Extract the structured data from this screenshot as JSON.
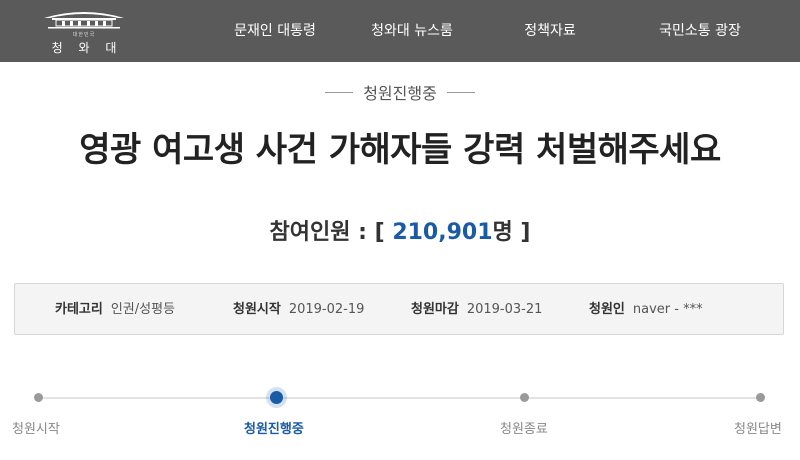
{
  "header": {
    "logo": {
      "subtitle": "대한민국",
      "name": "청 와 대"
    },
    "nav": [
      {
        "label": "문재인 대통령"
      },
      {
        "label": "청와대 뉴스룸"
      },
      {
        "label": "정책자료"
      },
      {
        "label": "국민소통 광장"
      }
    ]
  },
  "petition": {
    "status": "청원진행중",
    "title": "영광 여고생 사건 가해자들 강력 처벌해주세요",
    "participants": {
      "label": "참여인원 : [ ",
      "count": "210,901",
      "unit": "명 ]"
    },
    "info": [
      {
        "key": "카테고리",
        "value": "인권/성평등"
      },
      {
        "key": "청원시작",
        "value": "2019-02-19"
      },
      {
        "key": "청원마감",
        "value": "2019-03-21"
      },
      {
        "key": "청원인",
        "value": "naver - ***"
      }
    ]
  },
  "progress": {
    "steps": [
      {
        "label": "청원시작"
      },
      {
        "label": "청원진행중"
      },
      {
        "label": "청원종료"
      },
      {
        "label": "청원답변"
      }
    ],
    "current_step": 2
  },
  "colors": {
    "header_bg": "#5a5a5a",
    "accent": "#1a5ba6",
    "info_bg": "#f4f4f4"
  }
}
